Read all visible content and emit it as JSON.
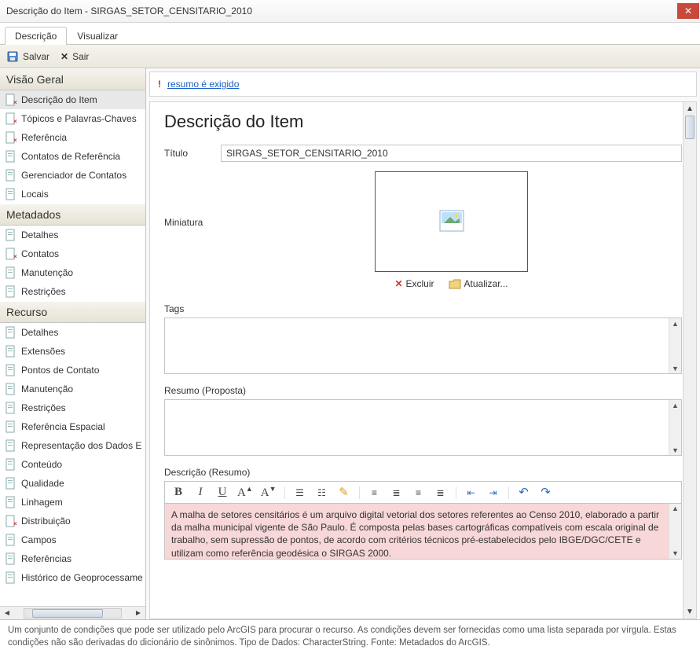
{
  "window": {
    "title": "Descrição do Item - SIRGAS_SETOR_CENSITARIO_2010"
  },
  "tabs": {
    "descricao": "Descrição",
    "visualizar": "Visualizar"
  },
  "toolbar": {
    "salvar": "Salvar",
    "sair": "Sair"
  },
  "sidebar": {
    "sections": {
      "visao_geral": "Visão Geral",
      "metadados": "Metadados",
      "recurso": "Recurso"
    },
    "items": {
      "descricao_item": "Descrição do Item",
      "topicos_palavras": "Tópicos e Palavras-Chaves",
      "referencia": "Referência",
      "contatos_referencia": "Contatos de Referência",
      "gerenciador_contatos": "Gerenciador de Contatos",
      "locais": "Locais",
      "detalhes": "Detalhes",
      "contatos": "Contatos",
      "manutencao": "Manutenção",
      "restricoes": "Restrições",
      "detalhes2": "Detalhes",
      "extensoes": "Extensões",
      "pontos_contato": "Pontos de Contato",
      "manutencao2": "Manutenção",
      "restricoes2": "Restrições",
      "ref_espacial": "Referência Espacial",
      "representacao": "Representação dos Dados E",
      "conteudo": "Conteúdo",
      "qualidade": "Qualidade",
      "linhagem": "Linhagem",
      "distribuicao": "Distribuição",
      "campos": "Campos",
      "referencias": "Referências",
      "historico_geo": "Histórico de Geoprocessame"
    }
  },
  "notice": {
    "text": "resumo é exigido"
  },
  "form": {
    "heading": "Descrição do Item",
    "titulo_label": "Título",
    "titulo_value": "SIRGAS_SETOR_CENSITARIO_2010",
    "miniatura_label": "Miniatura",
    "excluir": "Excluir",
    "atualizar": "Atualizar...",
    "tags_label": "Tags",
    "resumo_label": "Resumo (Proposta)",
    "descricao_label": "Descrição (Resumo)",
    "descricao_body": "A malha de setores censitários é um arquivo digital vetorial dos setores referentes ao Censo 2010, elaborado a partir da malha municipal vigente de São Paulo. É composta pelas bases cartográficas compatíveis com escala original de trabalho, sem supressão de pontos, de acordo com critérios técnicos pré-estabelecidos pelo IBGE/DGC/CETE e utilizam como referência geodésica o SIRGAS 2000."
  },
  "status": {
    "text": "Um conjunto de condições que pode ser utilizado pelo ArcGIS para procurar o recurso. As condições devem ser fornecidas como uma lista separada por vírgula. Estas condições não são derivadas do dicionário de sinônimos. Tipo de Dados: CharacterString. Fonte: Metadados do ArcGIS."
  }
}
